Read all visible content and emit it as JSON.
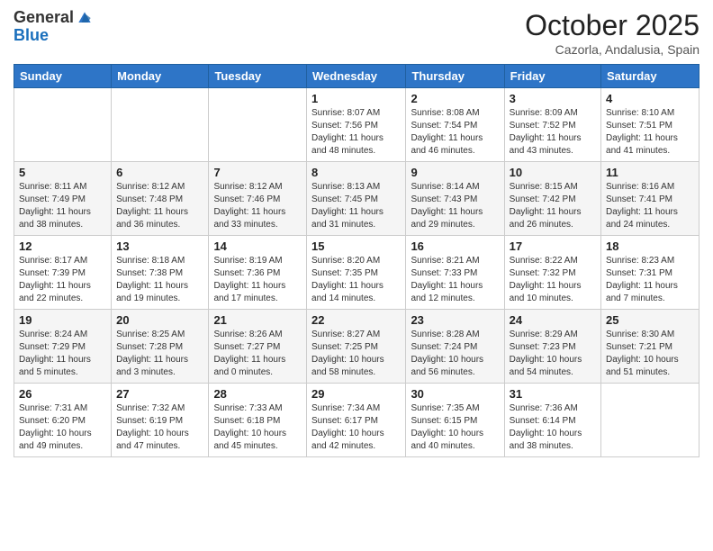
{
  "header": {
    "logo_general": "General",
    "logo_blue": "Blue",
    "month": "October 2025",
    "location": "Cazorla, Andalusia, Spain"
  },
  "days_of_week": [
    "Sunday",
    "Monday",
    "Tuesday",
    "Wednesday",
    "Thursday",
    "Friday",
    "Saturday"
  ],
  "weeks": [
    [
      {
        "day": "",
        "info": ""
      },
      {
        "day": "",
        "info": ""
      },
      {
        "day": "",
        "info": ""
      },
      {
        "day": "1",
        "info": "Sunrise: 8:07 AM\nSunset: 7:56 PM\nDaylight: 11 hours\nand 48 minutes."
      },
      {
        "day": "2",
        "info": "Sunrise: 8:08 AM\nSunset: 7:54 PM\nDaylight: 11 hours\nand 46 minutes."
      },
      {
        "day": "3",
        "info": "Sunrise: 8:09 AM\nSunset: 7:52 PM\nDaylight: 11 hours\nand 43 minutes."
      },
      {
        "day": "4",
        "info": "Sunrise: 8:10 AM\nSunset: 7:51 PM\nDaylight: 11 hours\nand 41 minutes."
      }
    ],
    [
      {
        "day": "5",
        "info": "Sunrise: 8:11 AM\nSunset: 7:49 PM\nDaylight: 11 hours\nand 38 minutes."
      },
      {
        "day": "6",
        "info": "Sunrise: 8:12 AM\nSunset: 7:48 PM\nDaylight: 11 hours\nand 36 minutes."
      },
      {
        "day": "7",
        "info": "Sunrise: 8:12 AM\nSunset: 7:46 PM\nDaylight: 11 hours\nand 33 minutes."
      },
      {
        "day": "8",
        "info": "Sunrise: 8:13 AM\nSunset: 7:45 PM\nDaylight: 11 hours\nand 31 minutes."
      },
      {
        "day": "9",
        "info": "Sunrise: 8:14 AM\nSunset: 7:43 PM\nDaylight: 11 hours\nand 29 minutes."
      },
      {
        "day": "10",
        "info": "Sunrise: 8:15 AM\nSunset: 7:42 PM\nDaylight: 11 hours\nand 26 minutes."
      },
      {
        "day": "11",
        "info": "Sunrise: 8:16 AM\nSunset: 7:41 PM\nDaylight: 11 hours\nand 24 minutes."
      }
    ],
    [
      {
        "day": "12",
        "info": "Sunrise: 8:17 AM\nSunset: 7:39 PM\nDaylight: 11 hours\nand 22 minutes."
      },
      {
        "day": "13",
        "info": "Sunrise: 8:18 AM\nSunset: 7:38 PM\nDaylight: 11 hours\nand 19 minutes."
      },
      {
        "day": "14",
        "info": "Sunrise: 8:19 AM\nSunset: 7:36 PM\nDaylight: 11 hours\nand 17 minutes."
      },
      {
        "day": "15",
        "info": "Sunrise: 8:20 AM\nSunset: 7:35 PM\nDaylight: 11 hours\nand 14 minutes."
      },
      {
        "day": "16",
        "info": "Sunrise: 8:21 AM\nSunset: 7:33 PM\nDaylight: 11 hours\nand 12 minutes."
      },
      {
        "day": "17",
        "info": "Sunrise: 8:22 AM\nSunset: 7:32 PM\nDaylight: 11 hours\nand 10 minutes."
      },
      {
        "day": "18",
        "info": "Sunrise: 8:23 AM\nSunset: 7:31 PM\nDaylight: 11 hours\nand 7 minutes."
      }
    ],
    [
      {
        "day": "19",
        "info": "Sunrise: 8:24 AM\nSunset: 7:29 PM\nDaylight: 11 hours\nand 5 minutes."
      },
      {
        "day": "20",
        "info": "Sunrise: 8:25 AM\nSunset: 7:28 PM\nDaylight: 11 hours\nand 3 minutes."
      },
      {
        "day": "21",
        "info": "Sunrise: 8:26 AM\nSunset: 7:27 PM\nDaylight: 11 hours\nand 0 minutes."
      },
      {
        "day": "22",
        "info": "Sunrise: 8:27 AM\nSunset: 7:25 PM\nDaylight: 10 hours\nand 58 minutes."
      },
      {
        "day": "23",
        "info": "Sunrise: 8:28 AM\nSunset: 7:24 PM\nDaylight: 10 hours\nand 56 minutes."
      },
      {
        "day": "24",
        "info": "Sunrise: 8:29 AM\nSunset: 7:23 PM\nDaylight: 10 hours\nand 54 minutes."
      },
      {
        "day": "25",
        "info": "Sunrise: 8:30 AM\nSunset: 7:21 PM\nDaylight: 10 hours\nand 51 minutes."
      }
    ],
    [
      {
        "day": "26",
        "info": "Sunrise: 7:31 AM\nSunset: 6:20 PM\nDaylight: 10 hours\nand 49 minutes."
      },
      {
        "day": "27",
        "info": "Sunrise: 7:32 AM\nSunset: 6:19 PM\nDaylight: 10 hours\nand 47 minutes."
      },
      {
        "day": "28",
        "info": "Sunrise: 7:33 AM\nSunset: 6:18 PM\nDaylight: 10 hours\nand 45 minutes."
      },
      {
        "day": "29",
        "info": "Sunrise: 7:34 AM\nSunset: 6:17 PM\nDaylight: 10 hours\nand 42 minutes."
      },
      {
        "day": "30",
        "info": "Sunrise: 7:35 AM\nSunset: 6:15 PM\nDaylight: 10 hours\nand 40 minutes."
      },
      {
        "day": "31",
        "info": "Sunrise: 7:36 AM\nSunset: 6:14 PM\nDaylight: 10 hours\nand 38 minutes."
      },
      {
        "day": "",
        "info": ""
      }
    ]
  ]
}
